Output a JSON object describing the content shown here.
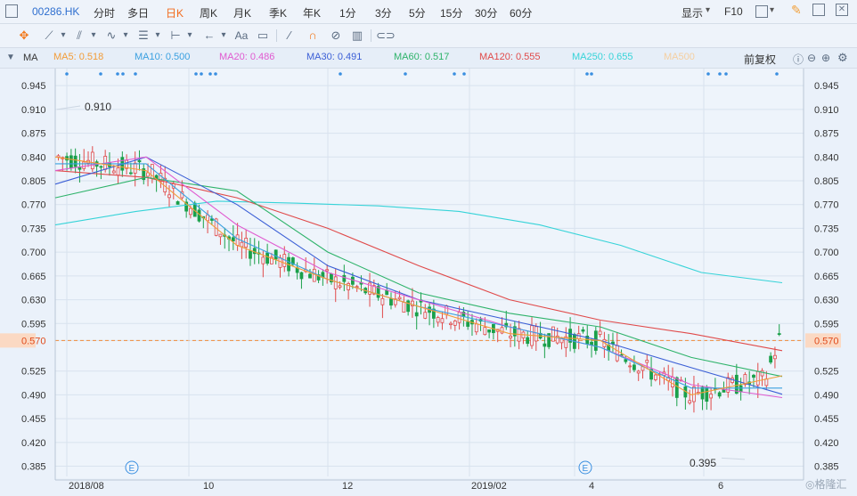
{
  "toolbar": {
    "code": "00286.HK",
    "periods": [
      "分时",
      "多日",
      "日K",
      "周K",
      "月K",
      "季K",
      "年K",
      "1分",
      "3分",
      "5分",
      "15分",
      "30分",
      "60分"
    ],
    "active_period": "日K",
    "display_label": "显示",
    "f10_label": "F10",
    "icons": [
      "sidebar-icon",
      "cursor-move-icon",
      "line-tool-icon",
      "channel-tool-icon",
      "wave-tool-icon",
      "ruler-tool-icon",
      "measure-icon",
      "arrow-tool-icon",
      "text-tool-icon",
      "note-icon",
      "pen-icon",
      "magnet-icon",
      "hide-icon",
      "trash-icon",
      "link-icon",
      "pencil-icon",
      "expand-icon",
      "close-icon"
    ],
    "text_tool_label": "Aa"
  },
  "indicators": {
    "label": "MA",
    "items": [
      {
        "text": "MA5: 0.518",
        "color": "#f29c38"
      },
      {
        "text": "MA10: 0.500",
        "color": "#3aa0e0"
      },
      {
        "text": "MA20: 0.486",
        "color": "#e05ad0"
      },
      {
        "text": "MA30: 0.491",
        "color": "#3b5fd6"
      },
      {
        "text": "MA60: 0.517",
        "color": "#2eb36a"
      },
      {
        "text": "MA120: 0.555",
        "color": "#e04a4a"
      },
      {
        "text": "MA250: 0.655",
        "color": "#36d3d8"
      },
      {
        "text": "MA500",
        "color": "#f5cfa0"
      }
    ],
    "adjust_label": "前复权"
  },
  "chart_data": {
    "type": "line",
    "title": "",
    "y_ticks": [
      "0.945",
      "0.910",
      "0.875",
      "0.840",
      "0.805",
      "0.770",
      "0.735",
      "0.700",
      "0.665",
      "0.630",
      "0.595",
      "0.570",
      "0.525",
      "0.490",
      "0.455",
      "0.420",
      "0.385"
    ],
    "ylim": [
      0.37,
      0.96
    ],
    "x_labels": [
      "2018/08",
      "10",
      "12",
      "2019/02",
      "4",
      "6"
    ],
    "current_price": "0.570",
    "high_label": "0.910",
    "low_label": "0.395",
    "event_marker": "E",
    "watermark": "格隆汇",
    "series": [
      {
        "name": "MA250",
        "color": "#36d3d8",
        "values": [
          0.74,
          0.76,
          0.775,
          0.772,
          0.768,
          0.76,
          0.74,
          0.71,
          0.67,
          0.655
        ]
      },
      {
        "name": "MA120",
        "color": "#e04a4a",
        "values": [
          0.82,
          0.81,
          0.78,
          0.735,
          0.68,
          0.63,
          0.6,
          0.58,
          0.555
        ]
      },
      {
        "name": "MA60",
        "color": "#2eb36a",
        "values": [
          0.78,
          0.81,
          0.79,
          0.7,
          0.64,
          0.61,
          0.59,
          0.545,
          0.517
        ]
      },
      {
        "name": "MA30",
        "color": "#3b5fd6",
        "values": [
          0.8,
          0.84,
          0.77,
          0.68,
          0.63,
          0.6,
          0.57,
          0.53,
          0.491
        ]
      },
      {
        "name": "MA20",
        "color": "#e05ad0",
        "values": [
          0.82,
          0.84,
          0.74,
          0.67,
          0.63,
          0.59,
          0.56,
          0.505,
          0.486
        ]
      },
      {
        "name": "MA10",
        "color": "#3aa0e0",
        "values": [
          0.83,
          0.83,
          0.72,
          0.66,
          0.62,
          0.59,
          0.56,
          0.5,
          0.5
        ]
      },
      {
        "name": "MA5",
        "color": "#f29c38",
        "values": [
          0.84,
          0.82,
          0.71,
          0.66,
          0.62,
          0.58,
          0.57,
          0.49,
          0.518
        ]
      }
    ]
  }
}
